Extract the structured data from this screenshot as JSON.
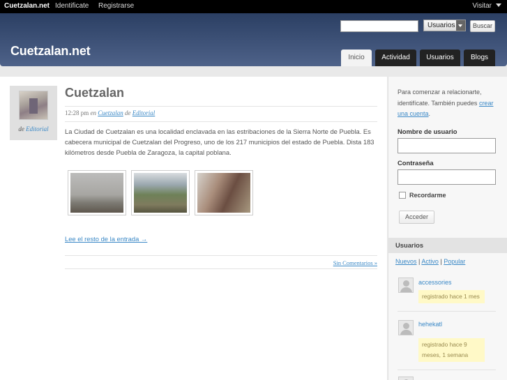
{
  "adminbar": {
    "site": "Cuetzalan.net",
    "login": "Identificate",
    "register": "Registrarse",
    "visit": "Visitar"
  },
  "header": {
    "title": "Cuetzalan.net",
    "search": {
      "value": "",
      "scope": "Usuarios",
      "button": "Buscar"
    },
    "nav": [
      "Inicio",
      "Actividad",
      "Usuarios",
      "Blogs"
    ],
    "active_nav": "Inicio"
  },
  "post": {
    "title": "Cuetzalan",
    "time": "12:28 pm",
    "in_word": "en",
    "category": "Cuetzalan",
    "by_word": "de",
    "author": "Editorial",
    "body": "La Ciudad de Cuetzalan es una localidad enclavada en las estribaciones de la Sierra Norte de Puebla. Es cabecera municipal de Cuetzalan del Progreso, uno de los 217 municipios del estado de Puebla. Dista 183 kilómetros desde Puebla de Zaragoza, la capital poblana.",
    "read_more": "Lee el resto de la entrada →",
    "comments": "Sin Comentarios »",
    "avatar_caption_prefix": "de",
    "avatar_caption_author": "Editorial"
  },
  "sidebar": {
    "intro": "Para comenzar a relacionarte, identifícate. También puedes",
    "create_link": "crear una cuenta",
    "intro_end": ".",
    "username_label": "Nombre de usuario",
    "password_label": "Contraseña",
    "remember": "Recordarme",
    "login_button": "Acceder",
    "members_title": "Usuarios",
    "filters": [
      "Nuevos",
      "Activo",
      "Popular"
    ],
    "filter_sep": "|",
    "members": [
      {
        "name": "accessories",
        "badge": "registrado hace 1 mes"
      },
      {
        "name": "hehekatl",
        "badge": "registrado hace 9 meses, 1 semana"
      }
    ]
  },
  "colors": {
    "header_top": "#2b3f63",
    "header_bottom": "#4e6289",
    "link": "#3a88c6",
    "badge_bg": "#fff9c7"
  }
}
